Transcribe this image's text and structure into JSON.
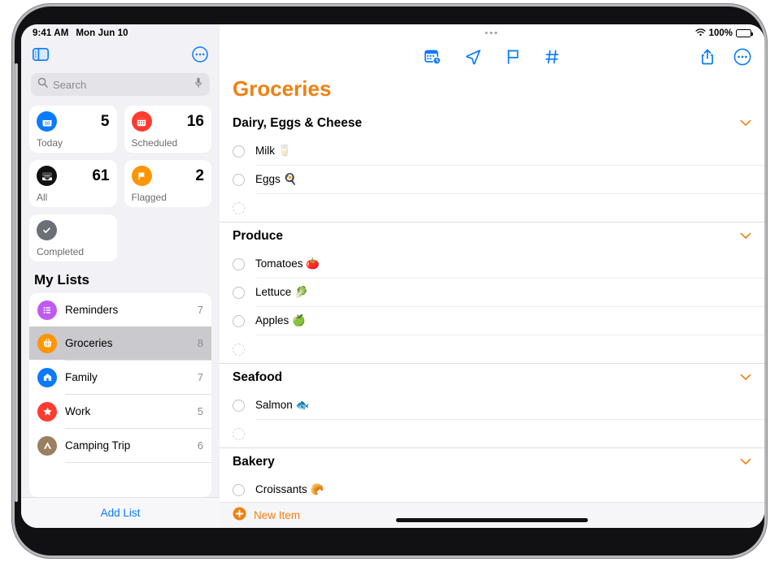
{
  "status_bar": {
    "time": "9:41 AM",
    "date": "Mon Jun 10",
    "battery_percent": "100%",
    "wifi_icon": "wifi-icon",
    "battery_icon": "battery-icon"
  },
  "sidebar": {
    "toggle_icon": "sidebar-toggle-icon",
    "more_icon": "more-circle-icon",
    "search": {
      "placeholder": "Search",
      "search_icon": "search-icon",
      "mic_icon": "microphone-icon"
    },
    "smart_lists": [
      {
        "label": "Today",
        "count": "5",
        "icon": "calendar-today-icon",
        "color": "#0a7aff"
      },
      {
        "label": "Scheduled",
        "count": "16",
        "icon": "calendar-icon",
        "color": "#ff3b30"
      },
      {
        "label": "All",
        "count": "61",
        "icon": "inbox-tray-icon",
        "color": "#111111"
      },
      {
        "label": "Flagged",
        "count": "2",
        "icon": "flag-icon",
        "color": "#ff9500"
      },
      {
        "label": "Completed",
        "count": "",
        "icon": "checkmark-icon",
        "color": "#6b7076"
      }
    ],
    "my_lists_header": "My Lists",
    "lists": [
      {
        "name": "Reminders",
        "count": "7",
        "icon": "bullet-list-icon",
        "color": "#bf5af2"
      },
      {
        "name": "Groceries",
        "count": "8",
        "icon": "basket-icon",
        "color": "#ff9500",
        "selected": true
      },
      {
        "name": "Family",
        "count": "7",
        "icon": "house-icon",
        "color": "#0a7aff"
      },
      {
        "name": "Work",
        "count": "5",
        "icon": "star-icon",
        "color": "#ff3b30"
      },
      {
        "name": "Camping Trip",
        "count": "6",
        "icon": "tent-icon",
        "color": "#9b7f5e"
      }
    ],
    "add_list_label": "Add List"
  },
  "main": {
    "window_grabber_icon": "window-grabber-icon",
    "title": "Groceries",
    "title_color": "#f08010",
    "toolbar": {
      "center_icons": [
        {
          "name": "calendar-clock-icon"
        },
        {
          "name": "location-arrow-icon"
        },
        {
          "name": "flag-outline-icon"
        },
        {
          "name": "hashtag-icon"
        }
      ],
      "right_icons": [
        {
          "name": "share-icon"
        },
        {
          "name": "more-circle-icon"
        }
      ]
    },
    "sections": [
      {
        "title": "Dairy, Eggs & Cheese",
        "chevron_icon": "chevron-down-icon",
        "items": [
          {
            "label": "Milk 🥛",
            "checked": false
          },
          {
            "label": "Eggs 🍳",
            "checked": false
          },
          {
            "label": "",
            "checked": false,
            "placeholder_row": true
          }
        ]
      },
      {
        "title": "Produce",
        "chevron_icon": "chevron-down-icon",
        "items": [
          {
            "label": "Tomatoes 🍅",
            "checked": false
          },
          {
            "label": "Lettuce 🥬",
            "checked": false
          },
          {
            "label": "Apples 🍏",
            "checked": false
          },
          {
            "label": "",
            "checked": false,
            "placeholder_row": true
          }
        ]
      },
      {
        "title": "Seafood",
        "chevron_icon": "chevron-down-icon",
        "items": [
          {
            "label": "Salmon 🐟",
            "checked": false
          },
          {
            "label": "",
            "checked": false,
            "placeholder_row": true
          }
        ]
      },
      {
        "title": "Bakery",
        "chevron_icon": "chevron-down-icon",
        "items": [
          {
            "label": "Croissants 🥐",
            "checked": false
          }
        ]
      }
    ],
    "new_item": {
      "label": "New Item",
      "icon": "plus-circle-icon",
      "color": "#f08010"
    }
  }
}
